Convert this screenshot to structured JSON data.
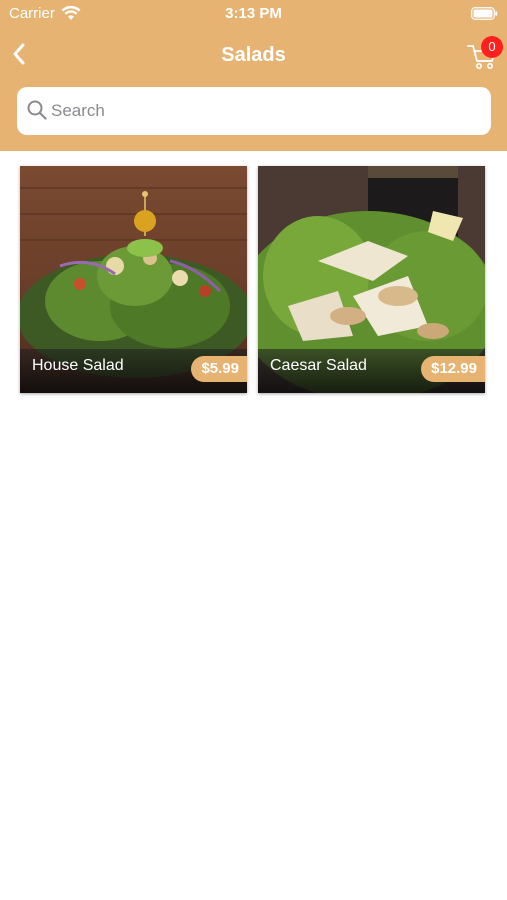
{
  "status_bar": {
    "carrier": "Carrier",
    "time": "3:13 PM"
  },
  "nav": {
    "title": "Salads",
    "back_icon": "chevron-left-icon",
    "cart_icon": "cart-icon",
    "cart_count": "0"
  },
  "search": {
    "placeholder": "Search",
    "value": ""
  },
  "products": [
    {
      "name": "House Salad",
      "price": "$5.99",
      "image": "house-salad-photo"
    },
    {
      "name": "Caesar Salad",
      "price": "$12.99",
      "image": "caesar-salad-photo"
    }
  ],
  "colors": {
    "header_bg": "#e6b373",
    "badge_red": "#ff1f1f",
    "price_bg": "#e6b373"
  }
}
